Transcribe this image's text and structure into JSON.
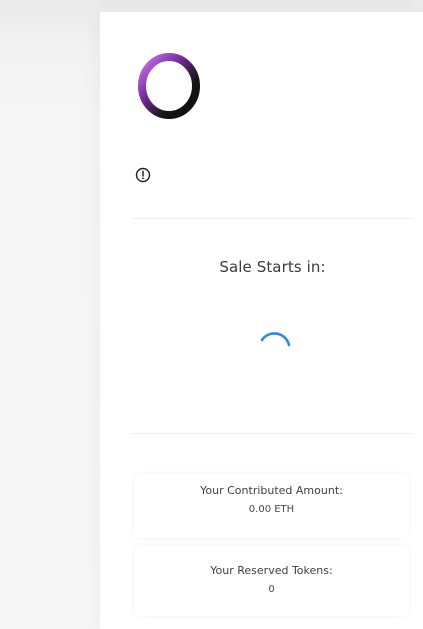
{
  "presale": {
    "sale_status_title": "Sale Starts in:",
    "contributed": {
      "label": "Your Contributed Amount:",
      "value": "0.00 ETH"
    },
    "reserved": {
      "label": "Your Reserved Tokens:",
      "value": "0"
    }
  },
  "icons": {
    "logo": "ring-logo-icon",
    "alert": "exclamation-circle-icon",
    "loading": "loading-spinner-icon"
  },
  "colors": {
    "logo_gradient_start": "#c061e8",
    "logo_gradient_end": "#111111",
    "spinner": "#2b8be6",
    "card_background": "#ffffff",
    "page_background": "#efefef"
  }
}
